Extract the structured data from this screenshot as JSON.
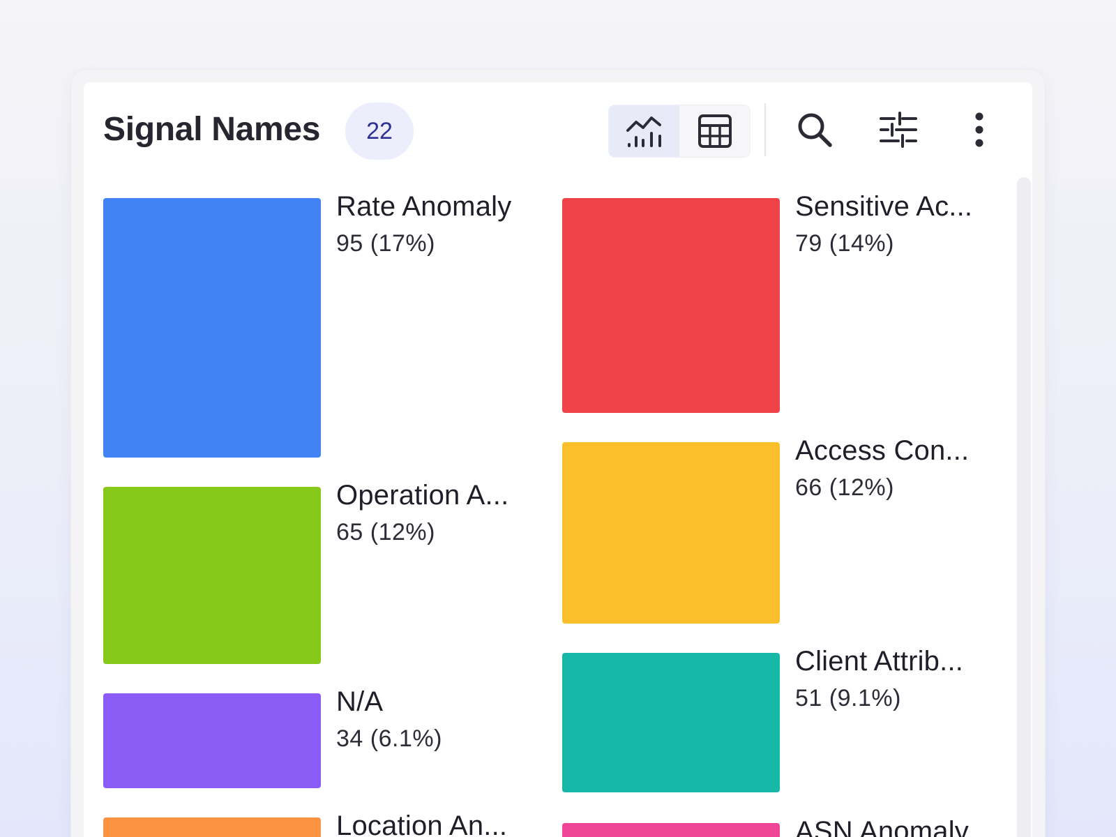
{
  "panel": {
    "title": "Signal Names",
    "count": "22"
  },
  "toolbar": {
    "chart_view_icon": "chart-view-icon",
    "table_view_icon": "table-view-icon",
    "search_icon": "search-icon",
    "filter_icon": "filter-sliders-icon",
    "more_icon": "more-vertical-icon"
  },
  "tiles": [
    {
      "label": "Rate Anomaly",
      "value": "95 (17%)",
      "color": "#4182f5"
    },
    {
      "label": "Sensitive Ac...",
      "value": "79 (14%)",
      "color": "#ef4349"
    },
    {
      "label": "Access Con...",
      "value": "66 (12%)",
      "color": "#fbbf2c"
    },
    {
      "label": "Operation A...",
      "value": "65 (12%)",
      "color": "#86c91b"
    },
    {
      "label": "Client Attrib...",
      "value": "51 (9.1%)",
      "color": "#18b8a8"
    },
    {
      "label": "N/A",
      "value": "34 (6.1%)",
      "color": "#8a5cf5"
    },
    {
      "label": "Location An...",
      "value": "",
      "color": "#fb9241"
    },
    {
      "label": "ASN Anomaly",
      "value": "",
      "color": "#ee4597"
    }
  ]
}
